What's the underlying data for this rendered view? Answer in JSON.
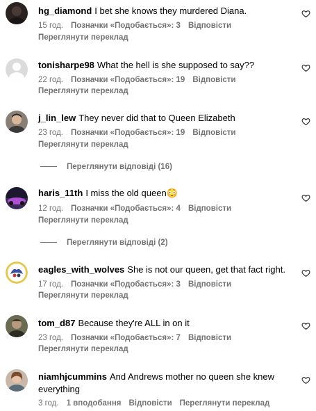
{
  "comments": [
    {
      "username": "hg_diamond",
      "text": "I bet she knows they murdered Diana.",
      "time": "15 год.",
      "likes": "Позначки «Подобається»: 3",
      "reply": "Відповісти",
      "translate": "Переглянути переклад"
    },
    {
      "username": "tonisharpe98",
      "text": "What the hell is she supposed to say??",
      "time": "22 год.",
      "likes": "Позначки «Подобається»: 19",
      "reply": "Відповісти",
      "translate": "Переглянути переклад"
    },
    {
      "username": "j_lin_lew",
      "text": "They never did that to Queen Elizabeth",
      "time": "23 год.",
      "likes": "Позначки «Подобається»: 19",
      "reply": "Відповісти",
      "translate": "Переглянути переклад",
      "view_replies": "Переглянути відповіді (16)"
    },
    {
      "username": "haris_11th",
      "text": "I miss the old queen😳",
      "time": "12 год.",
      "likes": "Позначки «Подобається»: 4",
      "reply": "Відповісти",
      "translate": "Переглянути переклад",
      "view_replies": "Переглянути відповіді (2)"
    },
    {
      "username": "eagles_with_wolves",
      "text": "She is not our queen, get that fact right.",
      "time": "17 год.",
      "likes": "Позначки «Подобається»: 3",
      "reply": "Відповісти",
      "translate": "Переглянути переклад"
    },
    {
      "username": "tom_d87",
      "text": "Because they're ALL in on it",
      "time": "23 год.",
      "likes": "Позначки «Подобається»: 7",
      "reply": "Відповісти",
      "translate": "Переглянути переклад"
    },
    {
      "username": "niamhjcummins",
      "text": "And Andrews mother no queen she knew everything",
      "time": "3 год.",
      "likes": "1 вподобання",
      "reply": "Відповісти",
      "translate": "Переглянути переклад"
    }
  ]
}
